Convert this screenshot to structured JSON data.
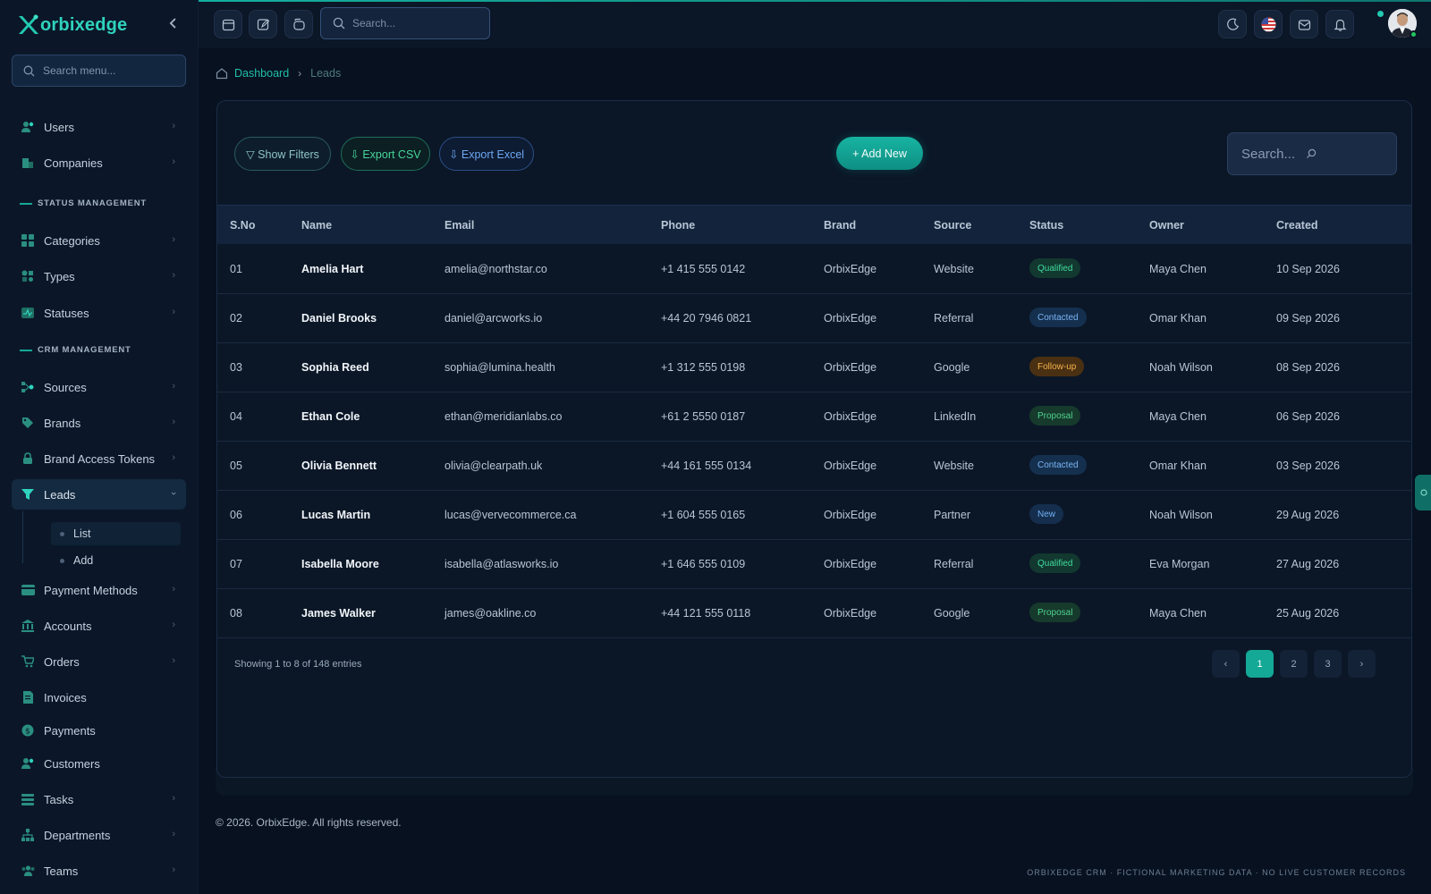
{
  "brand": {
    "logo_text": "orbixedge"
  },
  "sidebar": {
    "search_placeholder": "Search menu...",
    "items": [
      {
        "label": "Users"
      },
      {
        "label": "Companies"
      },
      {
        "label": "Categories"
      },
      {
        "label": "Types"
      },
      {
        "label": "Statuses"
      },
      {
        "label": "Sources"
      },
      {
        "label": "Brands"
      },
      {
        "label": "Brand Access Tokens"
      },
      {
        "label": "Leads"
      },
      {
        "label": "Payment Methods"
      },
      {
        "label": "Accounts"
      },
      {
        "label": "Orders"
      },
      {
        "label": "Invoices"
      },
      {
        "label": "Payments"
      },
      {
        "label": "Customers"
      },
      {
        "label": "Tasks"
      },
      {
        "label": "Departments"
      },
      {
        "label": "Teams"
      }
    ],
    "sections": {
      "status": "STATUS MANAGEMENT",
      "crm": "CRM MANAGEMENT"
    },
    "leads_sub": [
      {
        "label": "List"
      },
      {
        "label": "Add"
      }
    ]
  },
  "header": {
    "search_placeholder": "Search..."
  },
  "breadcrumb": {
    "home": "Dashboard",
    "current": "Leads"
  },
  "toolbar": {
    "show_filters": "▽ Show Filters",
    "export_csv": "⇩ Export CSV",
    "export_excel": "⇩ Export Excel",
    "add_new": "+ Add New",
    "search_placeholder": "Search..."
  },
  "table": {
    "columns": [
      "S.No",
      "Name",
      "Email",
      "Phone",
      "Brand",
      "Source",
      "Status",
      "Owner",
      "Created"
    ],
    "rows": [
      {
        "sno": "01",
        "name": "Amelia Hart",
        "email": "amelia@northstar.co",
        "phone": "+1 415 555 0142",
        "brand": "OrbixEdge",
        "source": "Website",
        "status": "Qualified",
        "owner": "Maya Chen",
        "created": "10 Sep 2026"
      },
      {
        "sno": "02",
        "name": "Daniel Brooks",
        "email": "daniel@arcworks.io",
        "phone": "+44 20 7946 0821",
        "brand": "OrbixEdge",
        "source": "Referral",
        "status": "Contacted",
        "owner": "Omar Khan",
        "created": "09 Sep 2026"
      },
      {
        "sno": "03",
        "name": "Sophia Reed",
        "email": "sophia@lumina.health",
        "phone": "+1 312 555 0198",
        "brand": "OrbixEdge",
        "source": "Google",
        "status": "Follow-up",
        "owner": "Noah Wilson",
        "created": "08 Sep 2026"
      },
      {
        "sno": "04",
        "name": "Ethan Cole",
        "email": "ethan@meridianlabs.co",
        "phone": "+61 2 5550 0187",
        "brand": "OrbixEdge",
        "source": "LinkedIn",
        "status": "Proposal",
        "owner": "Maya Chen",
        "created": "06 Sep 2026"
      },
      {
        "sno": "05",
        "name": "Olivia Bennett",
        "email": "olivia@clearpath.uk",
        "phone": "+44 161 555 0134",
        "brand": "OrbixEdge",
        "source": "Website",
        "status": "Contacted",
        "owner": "Omar Khan",
        "created": "03 Sep 2026"
      },
      {
        "sno": "06",
        "name": "Lucas Martin",
        "email": "lucas@vervecommerce.ca",
        "phone": "+1 604 555 0165",
        "brand": "OrbixEdge",
        "source": "Partner",
        "status": "New",
        "owner": "Noah Wilson",
        "created": "29 Aug 2026"
      },
      {
        "sno": "07",
        "name": "Isabella Moore",
        "email": "isabella@atlasworks.io",
        "phone": "+1 646 555 0109",
        "brand": "OrbixEdge",
        "source": "Referral",
        "status": "Qualified",
        "owner": "Eva Morgan",
        "created": "27 Aug 2026"
      },
      {
        "sno": "08",
        "name": "James Walker",
        "email": "james@oakline.co",
        "phone": "+44 121 555 0118",
        "brand": "OrbixEdge",
        "source": "Google",
        "status": "Proposal",
        "owner": "Maya Chen",
        "created": "25 Aug 2026"
      }
    ],
    "showing": "Showing 1 to 8 of 148 entries"
  },
  "pagination": {
    "prev": "‹",
    "pages": [
      "1",
      "2",
      "3"
    ],
    "next": "›",
    "active": "1"
  },
  "footer": {
    "copyright": "© 2026. OrbixEdge. All rights reserved.",
    "note": "ORBIXEDGE CRM · FICTIONAL MARKETING DATA · NO LIVE CUSTOMER RECORDS"
  },
  "colors": {
    "accent": "#14a896",
    "background": "#071120",
    "sidebar": "#0b1729"
  }
}
